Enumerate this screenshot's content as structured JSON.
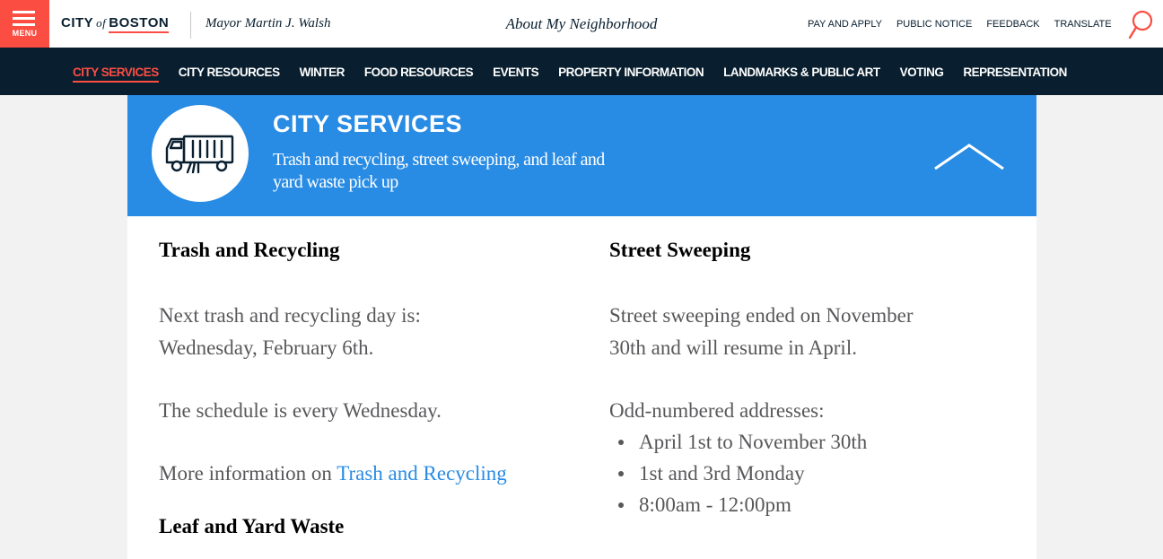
{
  "header": {
    "menu_label": "MENU",
    "logo_city": "CITY",
    "logo_of": "of",
    "logo_boston": "BOSTON",
    "mayor": "Mayor Martin J. Walsh",
    "page_heading": "About My Neighborhood",
    "utility_links": [
      "PAY AND APPLY",
      "PUBLIC NOTICE",
      "FEEDBACK",
      "TRANSLATE"
    ]
  },
  "nav": {
    "items": [
      "CITY SERVICES",
      "CITY RESOURCES",
      "WINTER",
      "FOOD RESOURCES",
      "EVENTS",
      "PROPERTY INFORMATION",
      "LANDMARKS & PUBLIC ART",
      "VOTING",
      "REPRESENTATION"
    ],
    "active_index": 0
  },
  "banner": {
    "title": "CITY SERVICES",
    "subtitle": "Trash and recycling, street sweeping, and leaf and yard waste pick up",
    "icon": "street-sweeper-truck-icon"
  },
  "trash": {
    "heading": "Trash and Recycling",
    "next_line1": "Next trash and recycling day is:",
    "next_line2": "Wednesday, February 6th.",
    "schedule": "The schedule is every Wednesday.",
    "more_prefix": "More information on ",
    "more_link": "Trash and Recycling"
  },
  "leaf": {
    "heading": "Leaf and Yard Waste"
  },
  "sweeping": {
    "heading": "Street Sweeping",
    "status_line1": "Street sweeping ended on November",
    "status_line2": "30th and will resume in April.",
    "odd_label": "Odd-numbered addresses:",
    "odd_items": [
      "April 1st to November 30th",
      "1st and 3rd Monday",
      "8:00am - 12:00pm"
    ]
  },
  "colors": {
    "accent_red": "#fb4d42",
    "navy": "#091f2f",
    "banner_blue": "#288be4",
    "link_blue": "#288be4",
    "body_gray": "#58585b"
  }
}
